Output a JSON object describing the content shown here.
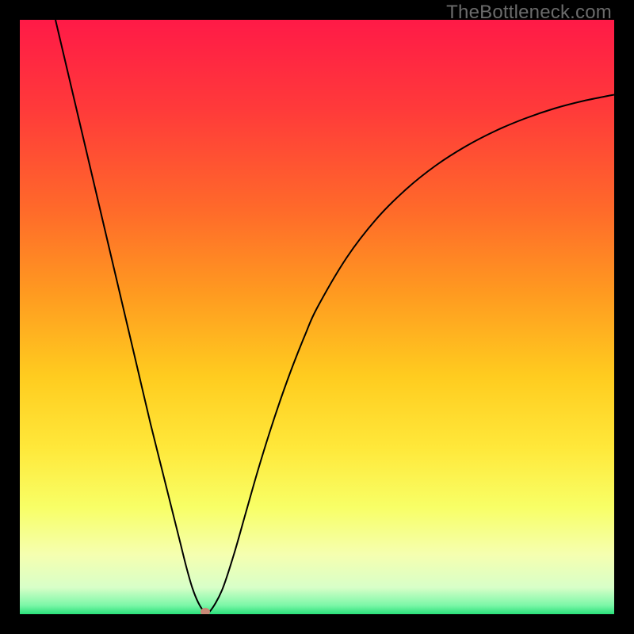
{
  "watermark": "TheBottleneck.com",
  "chart_data": {
    "type": "line",
    "title": "",
    "xlabel": "",
    "ylabel": "",
    "xlim": [
      0,
      100
    ],
    "ylim": [
      0,
      100
    ],
    "grid": false,
    "legend": false,
    "gradient_stops": [
      {
        "offset": 0.0,
        "color": "#ff1a47"
      },
      {
        "offset": 0.15,
        "color": "#ff3a3a"
      },
      {
        "offset": 0.32,
        "color": "#ff6a2a"
      },
      {
        "offset": 0.46,
        "color": "#ff9a20"
      },
      {
        "offset": 0.6,
        "color": "#ffcc1f"
      },
      {
        "offset": 0.72,
        "color": "#ffe83a"
      },
      {
        "offset": 0.82,
        "color": "#f8ff66"
      },
      {
        "offset": 0.9,
        "color": "#f5ffb0"
      },
      {
        "offset": 0.955,
        "color": "#d8ffc8"
      },
      {
        "offset": 0.985,
        "color": "#7cf7a8"
      },
      {
        "offset": 1.0,
        "color": "#29e07a"
      }
    ],
    "series": [
      {
        "name": "bottleneck-curve",
        "color": "#000000",
        "x": [
          6,
          8,
          10,
          12,
          14,
          16,
          18,
          20,
          22,
          24,
          26,
          27,
          28,
          29,
          30,
          31,
          32,
          34,
          36,
          38,
          40,
          42,
          44,
          46,
          48,
          50,
          55,
          60,
          65,
          70,
          75,
          80,
          85,
          90,
          95,
          100
        ],
        "y": [
          100,
          91.5,
          83,
          74.5,
          66,
          57.5,
          49,
          40.5,
          32,
          24,
          16,
          12,
          8,
          4.5,
          2,
          0.5,
          0.5,
          4,
          10,
          17,
          24,
          30.5,
          36.5,
          42,
          47,
          51.5,
          60,
          66.5,
          71.5,
          75.5,
          78.7,
          81.3,
          83.4,
          85.1,
          86.4,
          87.4
        ]
      }
    ],
    "marker": {
      "x": 31.2,
      "y": 0.4,
      "color": "#c98876",
      "rx": 6,
      "ry": 5
    }
  }
}
